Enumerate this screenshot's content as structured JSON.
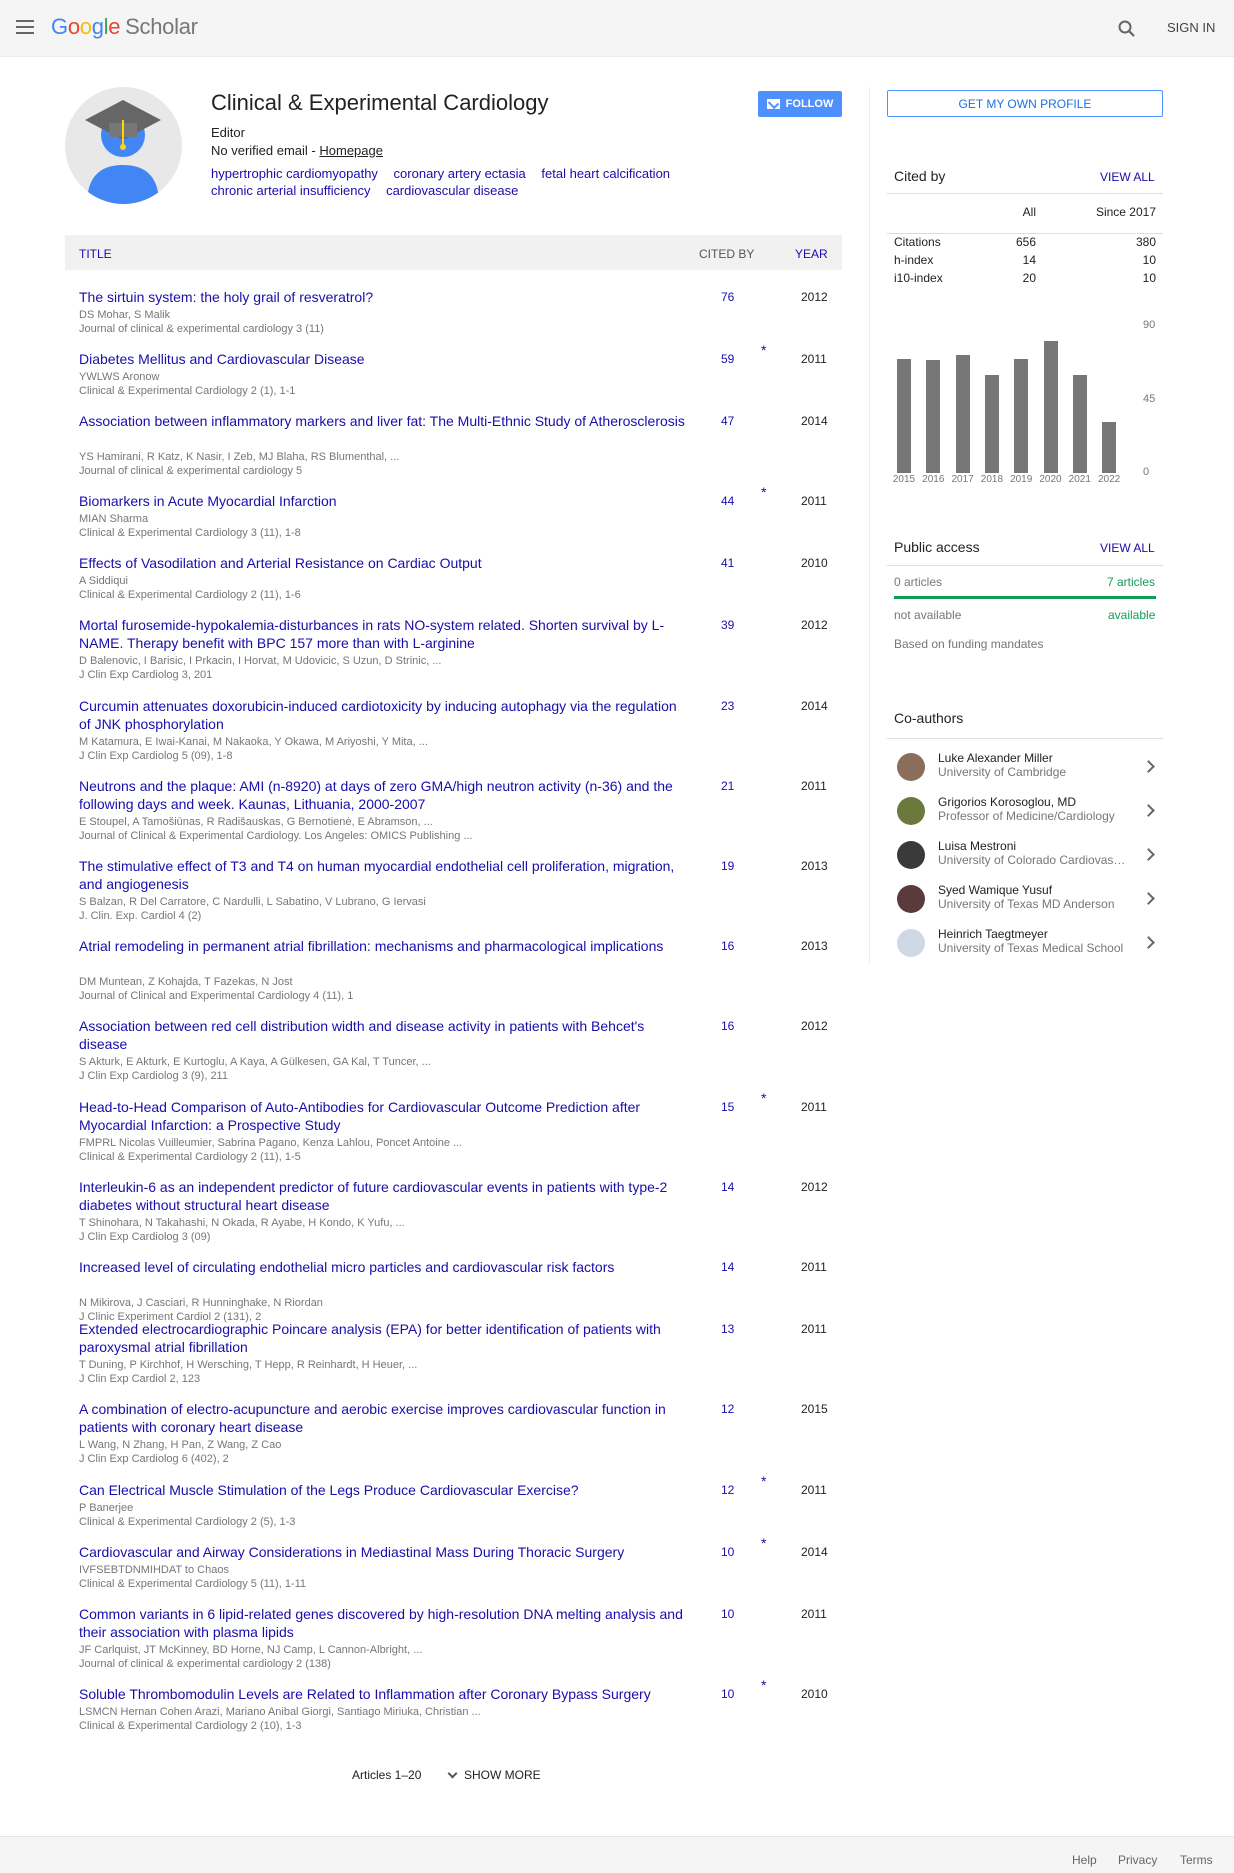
{
  "header": {
    "logo_google": [
      "G",
      "o",
      "o",
      "g",
      "l",
      "e"
    ],
    "logo_scholar": "Scholar",
    "signin_label": "SIGN IN"
  },
  "profile": {
    "name": "Clinical & Experimental Cardiology",
    "affiliation": "Editor",
    "email_text": "No verified email - ",
    "homepage_label": "Homepage",
    "follow_label": "FOLLOW",
    "interests": [
      "hypertrophic cardiomyopathy",
      "coronary artery ectasia",
      "fetal heart calcification",
      "chronic arterial insufficiency",
      "cardiovascular disease"
    ]
  },
  "table": {
    "col_title": "TITLE",
    "col_cited": "CITED BY",
    "col_year": "YEAR"
  },
  "articles": [
    {
      "title": "The sirtuin system: the holy grail of resveratrol?",
      "authors": "DS Mohar, S Malik",
      "venue": "Journal of clinical & experimental cardiology 3 (11)",
      "cited": "76",
      "star": "",
      "year": "2012"
    },
    {
      "title": "Diabetes Mellitus and Cardiovascular Disease",
      "authors": "YWLWS Aronow",
      "venue": "Clinical & Experimental Cardiology 2 (1), 1-1",
      "cited": "59",
      "star": "*",
      "year": "2011"
    },
    {
      "title": "Association between inflammatory markers and liver fat: The Multi-Ethnic Study of Atherosclerosis",
      "authors": "YS Hamirani, R Katz, K Nasir, I Zeb, MJ Blaha, RS Blumenthal, ...",
      "venue": "Journal of clinical & experimental cardiology 5",
      "cited": "47",
      "star": "",
      "year": "2014"
    },
    {
      "title": "Biomarkers in Acute Myocardial Infarction",
      "authors": "MIAN Sharma",
      "venue": "Clinical & Experimental Cardiology 3 (11), 1-8",
      "cited": "44",
      "star": "*",
      "year": "2011"
    },
    {
      "title": "Effects of Vasodilation and Arterial Resistance on Cardiac Output",
      "authors": "A Siddiqui",
      "venue": "Clinical & Experimental Cardiology 2 (11), 1-6",
      "cited": "41",
      "star": "",
      "year": "2010"
    },
    {
      "title": "Mortal furosemide-hypokalemia-disturbances in rats NO-system related. Shorten survival by L-NAME. Therapy benefit with BPC 157 more than with L-arginine",
      "authors": "D Balenovic, I Barisic, I Prkacin, I Horvat, M Udovicic, S Uzun, D Strinic, ...",
      "venue": "J Clin Exp Cardiolog 3, 201",
      "cited": "39",
      "star": "",
      "year": "2012"
    },
    {
      "title": "Curcumin attenuates doxorubicin-induced cardiotoxicity by inducing autophagy via the regulation of JNK phosphorylation",
      "authors": "M Katamura, E Iwai-Kanai, M Nakaoka, Y Okawa, M Ariyoshi, Y Mita, ...",
      "venue": "J Clin Exp Cardiolog 5 (09), 1-8",
      "cited": "23",
      "star": "",
      "year": "2014"
    },
    {
      "title": "Neutrons and the plaque: AMI (n-8920) at days of zero GMA/high neutron activity (n-36) and the following days and week. Kaunas, Lithuania, 2000-2007",
      "authors": "E Stoupel, A Tamošiūnas, R Radišauskas, G Bernotienė, E Abramson, ...",
      "venue": "Journal of Clinical & Experimental Cardiology. Los Angeles: OMICS Publishing ...",
      "cited": "21",
      "star": "",
      "year": "2011"
    },
    {
      "title": "The stimulative effect of T3 and T4 on human myocardial endothelial cell proliferation, migration, and angiogenesis",
      "authors": "S Balzan, R Del Carratore, C Nardulli, L Sabatino, V Lubrano, G Iervasi",
      "venue": "J. Clin. Exp. Cardiol 4 (2)",
      "cited": "19",
      "star": "",
      "year": "2013"
    },
    {
      "title": "Atrial remodeling in permanent atrial fibrillation: mechanisms and pharmacological implications",
      "authors": "DM Muntean, Z Kohajda, T Fazekas, N Jost",
      "venue": "Journal of Clinical and Experimental Cardiology 4 (11), 1",
      "cited": "16",
      "star": "",
      "year": "2013"
    },
    {
      "title": "Association between red cell distribution width and disease activity in patients with Behcet's disease",
      "authors": "S Akturk, E Akturk, E Kurtoglu, A Kaya, A Gülkesen, GA Kal, T Tuncer, ...",
      "venue": "J Clin Exp Cardiolog 3 (9), 211",
      "cited": "16",
      "star": "",
      "year": "2012"
    },
    {
      "title": "Head-to-Head Comparison of Auto-Antibodies for Cardiovascular Outcome Prediction after Myocardial Infarction: a Prospective Study",
      "authors": "FMPRL Nicolas Vuilleumier, Sabrina Pagano, Kenza Lahlou, Poncet Antoine ...",
      "venue": "Clinical & Experimental Cardiology 2 (11), 1-5",
      "cited": "15",
      "star": "*",
      "year": "2011"
    },
    {
      "title": "Interleukin-6 as an independent predictor of future cardiovascular events in patients with type-2 diabetes without structural heart disease",
      "authors": "T Shinohara, N Takahashi, N Okada, R Ayabe, H Kondo, K Yufu, ...",
      "venue": "J Clin Exp Cardiolog 3 (09)",
      "cited": "14",
      "star": "",
      "year": "2012"
    },
    {
      "title": "Increased level of circulating endothelial micro particles and cardiovascular risk factors",
      "authors": "N Mikirova, J Casciari, R Hunninghake, N Riordan",
      "venue": "J Clinic Experiment Cardiol 2 (131), 2",
      "cited": "14",
      "star": "",
      "year": "2011"
    },
    {
      "title": "Extended electrocardiographic Poincare analysis (EPA) for better identification of patients with paroxysmal atrial fibrillation",
      "authors": "T Duning, P Kirchhof, H Wersching, T Hepp, R Reinhardt, H Heuer, ...",
      "venue": "J Clin Exp Cardiol 2, 123",
      "cited": "13",
      "star": "",
      "year": "2011"
    },
    {
      "title": "A combination of electro-acupuncture and aerobic exercise improves cardiovascular function in patients with coronary heart disease",
      "authors": "L Wang, N Zhang, H Pan, Z Wang, Z Cao",
      "venue": "J Clin Exp Cardiolog 6 (402), 2",
      "cited": "12",
      "star": "",
      "year": "2015"
    },
    {
      "title": "Can Electrical Muscle Stimulation of the Legs Produce Cardiovascular Exercise?",
      "authors": "P Banerjee",
      "venue": "Clinical & Experimental Cardiology 2 (5), 1-3",
      "cited": "12",
      "star": "*",
      "year": "2011"
    },
    {
      "title": "Cardiovascular and Airway Considerations in Mediastinal Mass During Thoracic Surgery",
      "authors": "IVFSEBTDNMIHDAT to Chaos",
      "venue": "Clinical & Experimental Cardiology 5 (11), 1-11",
      "cited": "10",
      "star": "*",
      "year": "2014"
    },
    {
      "title": "Common variants in 6 lipid-related genes discovered by high-resolution DNA melting analysis and their association with plasma lipids",
      "authors": "JF Carlquist, JT McKinney, BD Horne, NJ Camp, L Cannon-Albright, ...",
      "venue": "Journal of clinical & experimental cardiology 2 (138)",
      "cited": "10",
      "star": "",
      "year": "2011"
    },
    {
      "title": "Soluble Thrombomodulin Levels are Related to Inflammation after Coronary Bypass Surgery",
      "authors": "LSMCN Hernan Cohen Arazi, Mariano Anibal Giorgi, Santiago Miriuka, Christian ...",
      "venue": "Clinical & Experimental Cardiology 2 (10), 1-3",
      "cited": "10",
      "star": "*",
      "year": "2010"
    }
  ],
  "pagination": {
    "range_label": "Articles 1–20",
    "show_more_label": "SHOW MORE"
  },
  "sidebar": {
    "own_profile_label": "GET MY OWN PROFILE",
    "cited_by_heading": "Cited by",
    "view_all_label": "VIEW ALL",
    "col_all": "All",
    "col_since": "Since 2017",
    "metrics": [
      {
        "label": "Citations",
        "all": "656",
        "since": "380"
      },
      {
        "label": "h-index",
        "all": "14",
        "since": "10"
      },
      {
        "label": "i10-index",
        "all": "20",
        "since": "10"
      }
    ],
    "public_access_heading": "Public access",
    "pa_left": "0 articles",
    "pa_right": "7 articles",
    "pa_progress": 1.0,
    "pa_not_available": "not available",
    "pa_available": "available",
    "pa_note": "Based on funding mandates",
    "coauthors_heading": "Co-authors",
    "coauthors": [
      {
        "name": "Luke Alexander Miller",
        "affiliation": "University of Cambridge"
      },
      {
        "name": "Grigorios Korosoglou, MD",
        "affiliation": "Professor of Medicine/Cardiology"
      },
      {
        "name": "Luisa Mestroni",
        "affiliation": "University of Colorado Cardiovascular"
      },
      {
        "name": "Syed Wamique Yusuf",
        "affiliation": "University of Texas MD Anderson"
      },
      {
        "name": "Heinrich Taegtmeyer",
        "affiliation": "University of Texas Medical School"
      }
    ]
  },
  "chart_data": {
    "type": "bar",
    "categories": [
      "2015",
      "2016",
      "2017",
      "2018",
      "2019",
      "2020",
      "2021",
      "2022"
    ],
    "values": [
      70,
      69,
      72,
      60,
      70,
      81,
      60,
      31
    ],
    "title": "",
    "xlabel": "",
    "ylabel": "",
    "ylim": [
      0,
      90
    ],
    "yticks": [
      "90",
      "45",
      "0"
    ],
    "bar_color": "#777777"
  },
  "footer": {
    "help": "Help",
    "privacy": "Privacy",
    "terms": "Terms"
  },
  "colors": {
    "link": "#1a0dab",
    "button": "#4d90fe",
    "available": "#0f9d58"
  }
}
